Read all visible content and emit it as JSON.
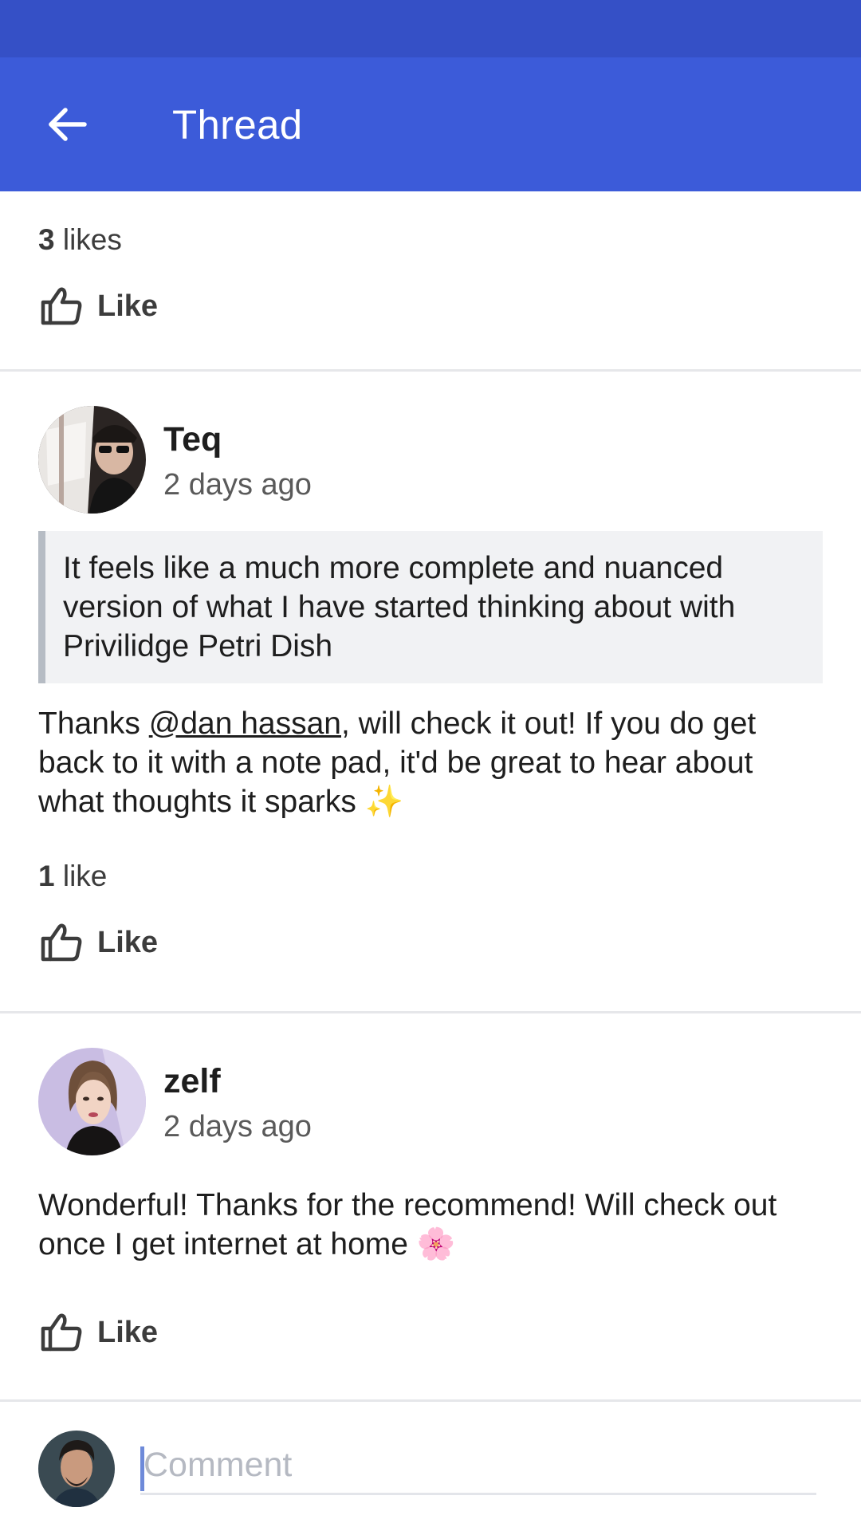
{
  "app_bar": {
    "back_icon": "arrow-left-icon",
    "title": "Thread"
  },
  "top_section": {
    "likes_number": "3",
    "likes_word": "likes",
    "like_label": "Like"
  },
  "comments": [
    {
      "author": "Teq",
      "timestamp": "2 days ago",
      "quote": "It feels like a much more complete and nuanced version of what I have started thinking about with Privilidge Petri Dish",
      "body_before_mention": "Thanks ",
      "mention": "@dan hassan",
      "body_after_mention": ", will check it out! If you do get back to it with a note pad, it'd be great to hear about what thoughts it sparks ",
      "emoji": "✨",
      "likes_number": "1",
      "likes_word": "like",
      "like_label": "Like"
    },
    {
      "author": "zelf",
      "timestamp": "2 days ago",
      "body": "Wonderful! Thanks for the recommend! Will check out once I get internet at home ",
      "emoji": "🌸",
      "like_label": "Like"
    }
  ],
  "composer": {
    "placeholder": "Comment"
  },
  "colors": {
    "status_bar": "#3550c6",
    "app_bar": "#3c5bd9",
    "divider": "#e6e7ea",
    "quote_bg": "#f1f2f4",
    "quote_border": "#b6bcc4"
  }
}
